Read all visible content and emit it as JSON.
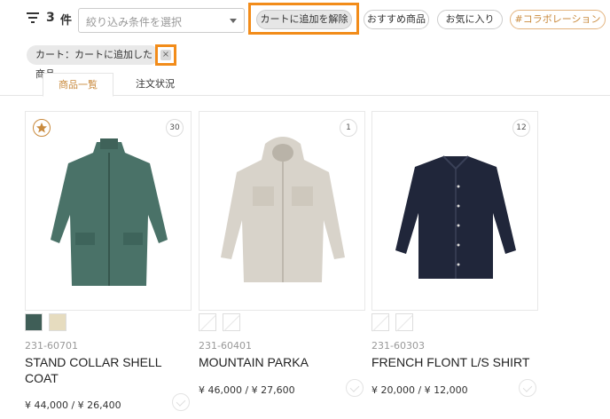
{
  "filter": {
    "icon": "filter-icon",
    "count": "3",
    "count_unit": "件",
    "select_placeholder": "絞り込み条件を選択",
    "tags": {
      "active": "カートに追加を解除",
      "recommended": "おすすめ商品",
      "favorites": "お気に入り",
      "collab": "#コラボレーション"
    }
  },
  "active_filter": {
    "label": "カート：カートに追加した商品",
    "remove_icon": "close-icon",
    "remove_symbol": "×"
  },
  "tabs": [
    "商品一覧",
    "注文状況"
  ],
  "colors": {
    "highlight": "#f28c1a",
    "accent": "#c98a3d"
  },
  "products": [
    {
      "count_badge": "30",
      "favorite_icon": "star-icon",
      "swatches": [
        "#3f5e57",
        "#e6dcbf"
      ],
      "sku": "231-60701",
      "name": "STAND COLLAR SHELL COAT",
      "price": "¥ 44,000 / ¥ 26,400",
      "garment_color": "#4a7268"
    },
    {
      "count_badge": "1",
      "swatches": [],
      "sku": "231-60401",
      "name": "MOUNTAIN PARKA",
      "price": "¥ 46,000 / ¥ 27,600",
      "garment_color": "#d8d3ca"
    },
    {
      "count_badge": "12",
      "swatches": [],
      "sku": "231-60303",
      "name": "FRENCH FLONT L/S SHIRT",
      "price": "¥ 20,000 / ¥ 12,000",
      "garment_color": "#20263a"
    }
  ]
}
